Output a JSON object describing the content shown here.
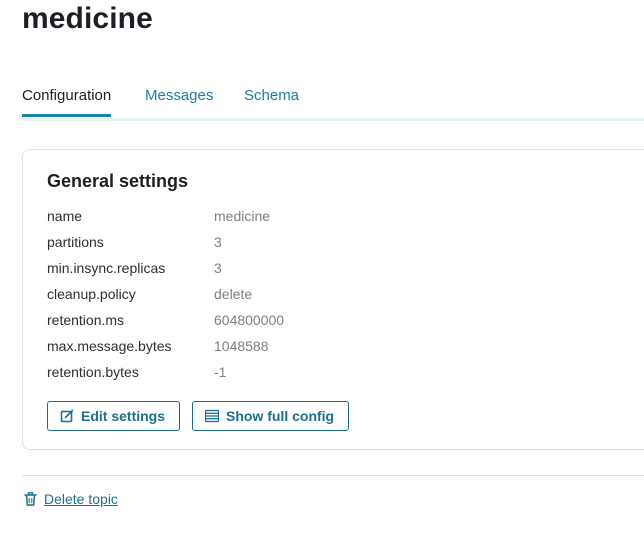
{
  "page": {
    "title": "medicine"
  },
  "tabs": [
    {
      "label": "Configuration",
      "active": true
    },
    {
      "label": "Messages",
      "active": false
    },
    {
      "label": "Schema",
      "active": false
    }
  ],
  "general_settings": {
    "title": "General settings",
    "rows": [
      {
        "key": "name",
        "value": "medicine"
      },
      {
        "key": "partitions",
        "value": "3"
      },
      {
        "key": "min.insync.replicas",
        "value": "3"
      },
      {
        "key": "cleanup.policy",
        "value": "delete"
      },
      {
        "key": "retention.ms",
        "value": "604800000"
      },
      {
        "key": "max.message.bytes",
        "value": "1048588"
      },
      {
        "key": "retention.bytes",
        "value": "-1"
      }
    ],
    "edit_button": {
      "label": "Edit settings",
      "icon": "edit-icon"
    },
    "config_button": {
      "label": "Show full config",
      "icon": "list-icon"
    }
  },
  "delete": {
    "label": "Delete topic",
    "icon": "trash-icon"
  },
  "colors": {
    "accent": "#1b6f91",
    "tab_link": "#1b7ea3",
    "value_text": "#7b8087",
    "border": "#dfe3e8"
  }
}
